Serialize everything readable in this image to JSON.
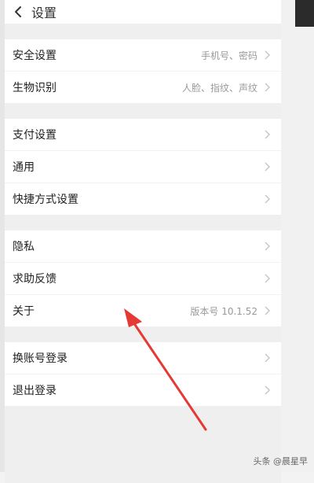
{
  "header": {
    "title": "设置",
    "back_icon": "chevron-left-icon"
  },
  "groups": [
    {
      "items": [
        {
          "label": "安全设置",
          "value": "手机号、密码"
        },
        {
          "label": "生物识别",
          "value": "人脸、指纹、声纹"
        }
      ]
    },
    {
      "items": [
        {
          "label": "支付设置",
          "value": ""
        },
        {
          "label": "通用",
          "value": ""
        },
        {
          "label": "快捷方式设置",
          "value": ""
        }
      ]
    },
    {
      "items": [
        {
          "label": "隐私",
          "value": ""
        },
        {
          "label": "求助反馈",
          "value": ""
        },
        {
          "label": "关于",
          "value": "版本号 10.1.52"
        }
      ]
    },
    {
      "items": [
        {
          "label": "换账号登录",
          "value": ""
        },
        {
          "label": "退出登录",
          "value": ""
        }
      ]
    }
  ],
  "watermark": "头条 @晨星早",
  "colors": {
    "accent_arrow": "#e53935",
    "row_text": "#222222",
    "value_text": "#999999"
  }
}
